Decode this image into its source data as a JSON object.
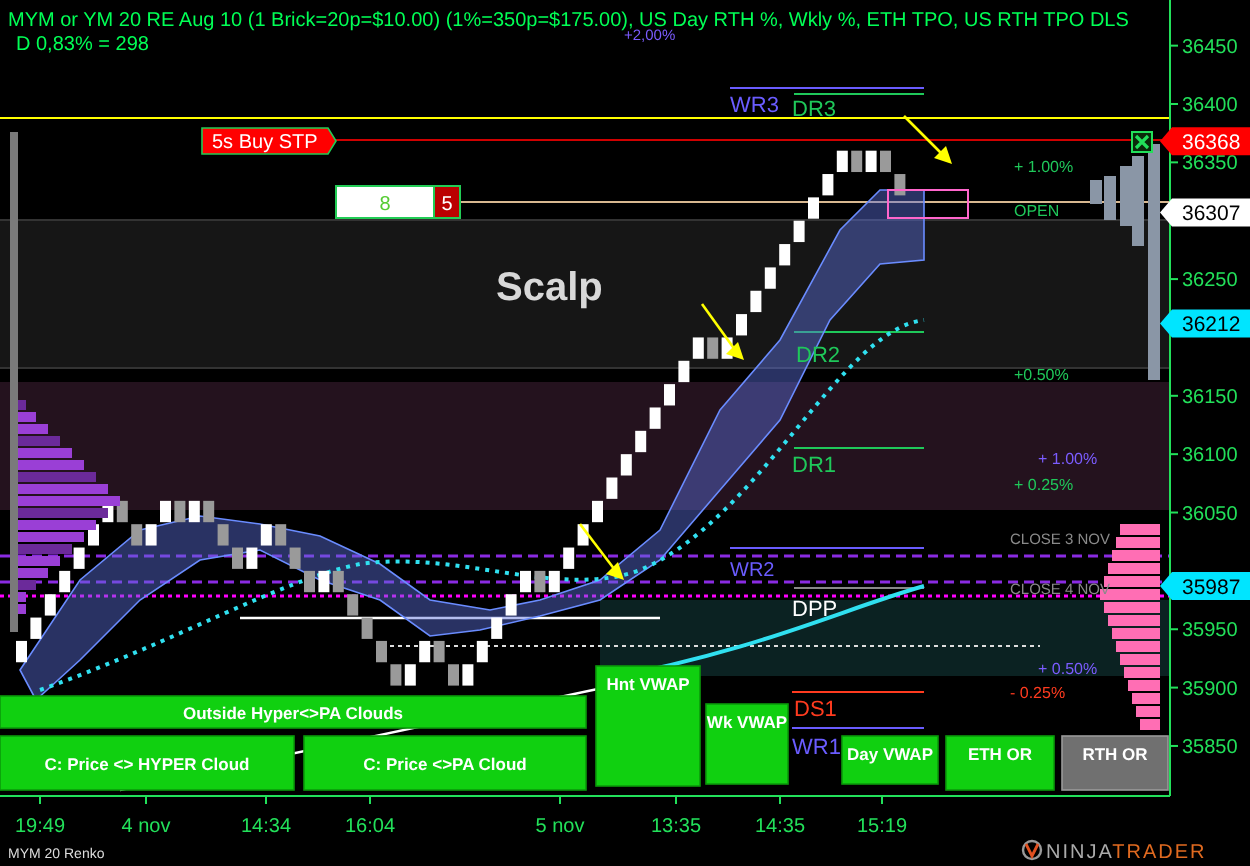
{
  "header": {
    "title": "MYM or YM 20 RE Aug 10 (1 Brick=20p=$10.00) (1%=350p=$175.00), US Day RTH %, Wkly %, ETH TPO, US RTH TPO DLS",
    "subtitle": "D 0,83% = 298"
  },
  "price_axis": {
    "ticks": [
      "36450",
      "36400",
      "36350",
      "36250",
      "36150",
      "36100",
      "36050",
      "35950",
      "35900",
      "35850"
    ],
    "markers": [
      {
        "value": "36368",
        "color": "#ff0000"
      },
      {
        "value": "36307",
        "color": "#ffffff"
      },
      {
        "value": "36212",
        "color": "#00e5ff"
      },
      {
        "value": "35987",
        "color": "#00e5ff"
      }
    ]
  },
  "time_axis": {
    "labels": [
      "19:49",
      "4 nov",
      "14:34",
      "16:04",
      "5 nov",
      "13:35",
      "14:35",
      "15:19"
    ]
  },
  "order": {
    "label": "5s Buy STP",
    "quantity": "8",
    "count": "5"
  },
  "zone_label": "Scalp",
  "chart_labels": [
    {
      "text": "+2,00%",
      "color": "#7b5cff"
    },
    {
      "text": "WR3",
      "color": "#6a5cff"
    },
    {
      "text": "DR3",
      "color": "#1fc85a"
    },
    {
      "text": "+ 1.00%",
      "color": "#1fc85a"
    },
    {
      "text": "OPEN",
      "color": "#1fc85a"
    },
    {
      "text": "DR2",
      "color": "#1fc85a"
    },
    {
      "text": "+0.50%",
      "color": "#1fc85a"
    },
    {
      "text": "DR1",
      "color": "#1fc85a"
    },
    {
      "text": "+ 1.00%",
      "color": "#7b5cff"
    },
    {
      "text": "+ 0.25%",
      "color": "#1fc85a"
    },
    {
      "text": "CLOSE 3 NOV",
      "color": "#8a8a8a"
    },
    {
      "text": "WR2",
      "color": "#6a5cff"
    },
    {
      "text": "CLOSE 4 NOV",
      "color": "#8a8a8a"
    },
    {
      "text": "DPP",
      "color": "#ffffff"
    },
    {
      "text": "+ 0.50%",
      "color": "#7b5cff"
    },
    {
      "text": "- 0.25%",
      "color": "#ff3b1f"
    },
    {
      "text": "DS1",
      "color": "#ff3b1f"
    },
    {
      "text": "WR1",
      "color": "#6a5cff"
    }
  ],
  "indicator_buttons": [
    {
      "label": "Outside Hyper<>PA Clouds",
      "on": true
    },
    {
      "label": "C: Price <> HYPER Cloud",
      "on": true
    },
    {
      "label": "C: Price <>PA Cloud",
      "on": true
    },
    {
      "label": "Hnt VWAP",
      "on": true
    },
    {
      "label": "Wk VWAP",
      "on": true
    },
    {
      "label": "Day VWAP",
      "on": true
    },
    {
      "label": "ETH OR",
      "on": true
    },
    {
      "label": "RTH OR",
      "on": false
    }
  ],
  "instrument_label": "MYM 20 Renko",
  "logo": {
    "part_1": "NINJA",
    "part_2": "TRADER"
  }
}
